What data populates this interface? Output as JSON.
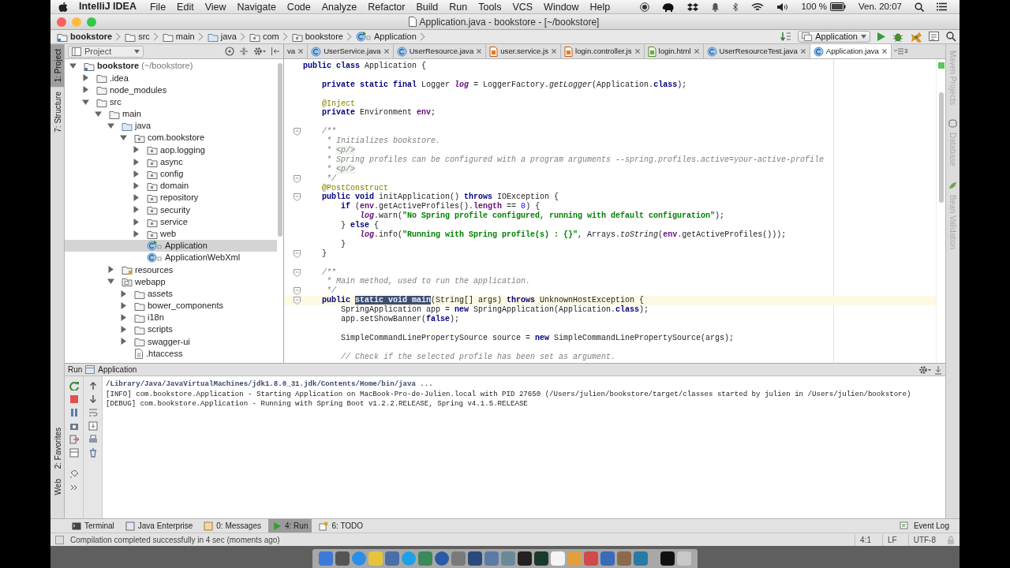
{
  "menubar": {
    "app": "IntelliJ IDEA",
    "menus": [
      "File",
      "Edit",
      "View",
      "Navigate",
      "Code",
      "Analyze",
      "Refactor",
      "Build",
      "Run",
      "Tools",
      "VCS",
      "Window",
      "Help"
    ],
    "battery": "100 %",
    "clock": "Ven. 20:07"
  },
  "window": {
    "title": "Application.java - bookstore - [~/bookstore]"
  },
  "breadcrumbs": [
    {
      "label": "bookstore",
      "kind": "project"
    },
    {
      "label": "src",
      "kind": "folder"
    },
    {
      "label": "main",
      "kind": "folder"
    },
    {
      "label": "java",
      "kind": "source"
    },
    {
      "label": "com",
      "kind": "package"
    },
    {
      "label": "bookstore",
      "kind": "package"
    },
    {
      "label": "Application",
      "kind": "class"
    }
  ],
  "run_config": "Application",
  "left_strip_top": [
    {
      "label": "1: Project",
      "selected": true
    },
    {
      "label": "7: Structure",
      "selected": false
    }
  ],
  "left_strip_bottom": [
    {
      "label": "2: Favorites",
      "selected": false
    },
    {
      "label": "Web",
      "selected": false
    }
  ],
  "project_panel": {
    "title": "Project",
    "tree": [
      {
        "label": "bookstore",
        "hint": "(~/bookstore)",
        "kind": "project",
        "expanded": true,
        "selected": false,
        "children": [
          {
            "label": ".idea",
            "kind": "folder",
            "expanded": false,
            "selected": false
          },
          {
            "label": "node_modules",
            "kind": "folder",
            "expanded": false,
            "selected": false
          },
          {
            "label": "src",
            "kind": "folder",
            "expanded": true,
            "selected": false,
            "children": [
              {
                "label": "main",
                "kind": "folder",
                "expanded": true,
                "selected": false,
                "children": [
                  {
                    "label": "java",
                    "kind": "source",
                    "expanded": true,
                    "selected": false,
                    "children": [
                      {
                        "label": "com.bookstore",
                        "kind": "package",
                        "expanded": true,
                        "selected": false,
                        "children": [
                          {
                            "label": "aop.logging",
                            "kind": "package",
                            "expanded": false,
                            "selected": false
                          },
                          {
                            "label": "async",
                            "kind": "package",
                            "expanded": false,
                            "selected": false
                          },
                          {
                            "label": "config",
                            "kind": "package",
                            "expanded": false,
                            "selected": false
                          },
                          {
                            "label": "domain",
                            "kind": "package",
                            "expanded": false,
                            "selected": false
                          },
                          {
                            "label": "repository",
                            "kind": "package",
                            "expanded": false,
                            "selected": false
                          },
                          {
                            "label": "security",
                            "kind": "package",
                            "expanded": false,
                            "selected": false
                          },
                          {
                            "label": "service",
                            "kind": "package",
                            "expanded": false,
                            "selected": false
                          },
                          {
                            "label": "web",
                            "kind": "package",
                            "expanded": false,
                            "selected": false
                          },
                          {
                            "label": "Application",
                            "kind": "runclass",
                            "selected": true
                          },
                          {
                            "label": "ApplicationWebXml",
                            "kind": "class",
                            "selected": false
                          }
                        ]
                      }
                    ]
                  },
                  {
                    "label": "resources",
                    "kind": "resources",
                    "expanded": false,
                    "selected": false
                  },
                  {
                    "label": "webapp",
                    "kind": "webapp",
                    "expanded": true,
                    "selected": false,
                    "children": [
                      {
                        "label": "assets",
                        "kind": "folder",
                        "expanded": false,
                        "selected": false
                      },
                      {
                        "label": "bower_components",
                        "kind": "folder",
                        "expanded": false,
                        "selected": false
                      },
                      {
                        "label": "i18n",
                        "kind": "folder",
                        "expanded": false,
                        "selected": false
                      },
                      {
                        "label": "scripts",
                        "kind": "folder",
                        "expanded": false,
                        "selected": false
                      },
                      {
                        "label": "swagger-ui",
                        "kind": "folder",
                        "expanded": false,
                        "selected": false
                      },
                      {
                        "label": ".htaccess",
                        "kind": "file",
                        "selected": false
                      }
                    ]
                  }
                ]
              }
            ]
          }
        ]
      }
    ]
  },
  "editor": {
    "tabs": [
      {
        "label": "va",
        "kind": "partial",
        "selected": false
      },
      {
        "label": "UserService.java",
        "kind": "java",
        "selected": false
      },
      {
        "label": "UserResource.java",
        "kind": "java",
        "selected": false
      },
      {
        "label": "user.service.js",
        "kind": "js",
        "selected": false
      },
      {
        "label": "login.controller.js",
        "kind": "js",
        "selected": false
      },
      {
        "label": "login.html",
        "kind": "html",
        "selected": false
      },
      {
        "label": "UserResourceTest.java",
        "kind": "java",
        "selected": false
      },
      {
        "label": "Application.java",
        "kind": "java",
        "selected": true
      }
    ],
    "overflow": "3",
    "lines": [
      {
        "kind": "code",
        "fold": false,
        "current": false,
        "tokens": [
          {
            "kind": "keyword",
            "text": "public class "
          },
          {
            "kind": "plain",
            "text": "Application {"
          }
        ]
      },
      {
        "kind": "blank"
      },
      {
        "kind": "code",
        "fold": false,
        "current": false,
        "tokens": [
          {
            "kind": "keyword",
            "text": "    private static final "
          },
          {
            "kind": "plain",
            "text": "Logger "
          },
          {
            "kind": "static_field",
            "text": "log"
          },
          {
            "kind": "plain",
            "text": " = LoggerFactory."
          },
          {
            "kind": "italic",
            "text": "getLogger"
          },
          {
            "kind": "plain",
            "text": "(Application."
          },
          {
            "kind": "keyword",
            "text": "class"
          },
          {
            "kind": "plain",
            "text": ");"
          }
        ]
      },
      {
        "kind": "blank"
      },
      {
        "kind": "code",
        "fold": false,
        "current": false,
        "tokens": [
          {
            "kind": "annotation",
            "text": "    @Inject"
          }
        ]
      },
      {
        "kind": "code",
        "fold": false,
        "current": false,
        "tokens": [
          {
            "kind": "keyword",
            "text": "    private "
          },
          {
            "kind": "plain",
            "text": "Environment "
          },
          {
            "kind": "field",
            "text": "env"
          },
          {
            "kind": "plain",
            "text": ";"
          }
        ]
      },
      {
        "kind": "blank"
      },
      {
        "kind": "code",
        "fold": true,
        "current": false,
        "tokens": [
          {
            "kind": "comment",
            "text": "    /**"
          }
        ]
      },
      {
        "kind": "code",
        "fold": false,
        "current": false,
        "tokens": [
          {
            "kind": "comment",
            "text": "     * Initializes bookstore."
          }
        ]
      },
      {
        "kind": "code",
        "fold": false,
        "current": false,
        "tokens": [
          {
            "kind": "comment",
            "text": "     * "
          },
          {
            "kind": "doc_tag",
            "text": "<p/>"
          }
        ]
      },
      {
        "kind": "code",
        "fold": false,
        "current": false,
        "tokens": [
          {
            "kind": "comment",
            "text": "     * Spring profiles can be configured with a program arguments --spring.profiles.active=your-active-profile"
          }
        ]
      },
      {
        "kind": "code",
        "fold": false,
        "current": false,
        "tokens": [
          {
            "kind": "comment",
            "text": "     * "
          },
          {
            "kind": "doc_tag",
            "text": "<p/>"
          }
        ]
      },
      {
        "kind": "code",
        "fold": true,
        "current": false,
        "tokens": [
          {
            "kind": "comment",
            "text": "     */"
          }
        ]
      },
      {
        "kind": "code",
        "fold": false,
        "current": false,
        "tokens": [
          {
            "kind": "annotation",
            "text": "    @PostConstruct"
          }
        ]
      },
      {
        "kind": "code",
        "fold": true,
        "current": false,
        "tokens": [
          {
            "kind": "keyword",
            "text": "    public void "
          },
          {
            "kind": "plain",
            "text": "initApplication() "
          },
          {
            "kind": "keyword",
            "text": "throws "
          },
          {
            "kind": "plain",
            "text": "IOException {"
          }
        ]
      },
      {
        "kind": "code",
        "fold": false,
        "current": false,
        "tokens": [
          {
            "kind": "keyword",
            "text": "        if "
          },
          {
            "kind": "plain",
            "text": "("
          },
          {
            "kind": "field",
            "text": "env"
          },
          {
            "kind": "plain",
            "text": ".getActiveProfiles()."
          },
          {
            "kind": "field",
            "text": "length"
          },
          {
            "kind": "plain",
            "text": " == "
          },
          {
            "kind": "number",
            "text": "0"
          },
          {
            "kind": "plain",
            "text": ") {"
          }
        ]
      },
      {
        "kind": "code",
        "fold": false,
        "current": false,
        "tokens": [
          {
            "kind": "static_field",
            "text": "            log"
          },
          {
            "kind": "plain",
            "text": ".warn("
          },
          {
            "kind": "string",
            "text": "\"No Spring profile configured, running with default configuration\""
          },
          {
            "kind": "plain",
            "text": ");"
          }
        ]
      },
      {
        "kind": "code",
        "fold": false,
        "current": false,
        "tokens": [
          {
            "kind": "plain",
            "text": "        } "
          },
          {
            "kind": "keyword",
            "text": "else "
          },
          {
            "kind": "plain",
            "text": "{"
          }
        ]
      },
      {
        "kind": "code",
        "fold": false,
        "current": false,
        "tokens": [
          {
            "kind": "static_field",
            "text": "            log"
          },
          {
            "kind": "plain",
            "text": ".info("
          },
          {
            "kind": "string",
            "text": "\"Running with Spring profile(s) : {}\""
          },
          {
            "kind": "plain",
            "text": ", Arrays."
          },
          {
            "kind": "italic",
            "text": "toString"
          },
          {
            "kind": "plain",
            "text": "("
          },
          {
            "kind": "field",
            "text": "env"
          },
          {
            "kind": "plain",
            "text": ".getActiveProfiles()));"
          }
        ]
      },
      {
        "kind": "code",
        "fold": false,
        "current": false,
        "tokens": [
          {
            "kind": "plain",
            "text": "        }"
          }
        ]
      },
      {
        "kind": "code",
        "fold": true,
        "current": false,
        "tokens": [
          {
            "kind": "plain",
            "text": "    }"
          }
        ]
      },
      {
        "kind": "blank"
      },
      {
        "kind": "code",
        "fold": true,
        "current": false,
        "tokens": [
          {
            "kind": "comment",
            "text": "    /**"
          }
        ]
      },
      {
        "kind": "code",
        "fold": false,
        "current": false,
        "tokens": [
          {
            "kind": "comment",
            "text": "     * Main method, used to run the application."
          }
        ]
      },
      {
        "kind": "code",
        "fold": true,
        "current": false,
        "tokens": [
          {
            "kind": "comment",
            "text": "     */"
          }
        ]
      },
      {
        "kind": "code",
        "fold": true,
        "current": true,
        "tokens": [
          {
            "kind": "keyword",
            "text": "    public "
          },
          {
            "kind": "selection",
            "text": "static void main"
          },
          {
            "kind": "plain",
            "text": "(String[] args) "
          },
          {
            "kind": "keyword",
            "text": "throws "
          },
          {
            "kind": "plain",
            "text": "UnknownHostException {"
          }
        ]
      },
      {
        "kind": "code",
        "fold": false,
        "current": false,
        "tokens": [
          {
            "kind": "plain",
            "text": "        SpringApplication app = "
          },
          {
            "kind": "keyword",
            "text": "new "
          },
          {
            "kind": "plain",
            "text": "SpringApplication(Application."
          },
          {
            "kind": "keyword",
            "text": "class"
          },
          {
            "kind": "plain",
            "text": ");"
          }
        ]
      },
      {
        "kind": "code",
        "fold": false,
        "current": false,
        "tokens": [
          {
            "kind": "plain",
            "text": "        app.setShowBanner("
          },
          {
            "kind": "keyword",
            "text": "false"
          },
          {
            "kind": "plain",
            "text": ");"
          }
        ]
      },
      {
        "kind": "blank"
      },
      {
        "kind": "code",
        "fold": false,
        "current": false,
        "tokens": [
          {
            "kind": "plain",
            "text": "        SimpleCommandLinePropertySource source = "
          },
          {
            "kind": "keyword",
            "text": "new "
          },
          {
            "kind": "plain",
            "text": "SimpleCommandLinePropertySource(args);"
          }
        ]
      },
      {
        "kind": "blank"
      },
      {
        "kind": "code",
        "fold": false,
        "current": false,
        "tokens": [
          {
            "kind": "comment",
            "text": "        // Check if the selected profile has been set as argument."
          }
        ]
      }
    ]
  },
  "right_strip": [
    "Maven Projects",
    "Database",
    "Bean Validation"
  ],
  "run_panel": {
    "title": "Run",
    "config": "Application",
    "console": [
      {
        "kind": "command",
        "text": "/Library/Java/JavaVirtualMachines/jdk1.8.0_31.jdk/Contents/Home/bin/java ..."
      },
      {
        "kind": "output",
        "text": "[INFO] com.bookstore.Application - Starting Application on MacBook-Pro-de-Julien.local with PID 27650 (/Users/julien/bookstore/target/classes started by julien in /Users/julien/bookstore)"
      },
      {
        "kind": "output",
        "text": "[DEBUG] com.bookstore.Application - Running with Spring Boot v1.2.2.RELEASE, Spring v4.1.5.RELEASE"
      }
    ]
  },
  "tool_tabs": [
    {
      "label": "Terminal",
      "selected": false
    },
    {
      "label": "Java Enterprise",
      "selected": false
    },
    {
      "label": "0: Messages",
      "selected": false
    },
    {
      "label": "4: Run",
      "selected": true
    },
    {
      "label": "6: TODO",
      "selected": false
    }
  ],
  "event_log": "Event Log",
  "status_bar": {
    "message": "Compilation completed successfully in 4 sec (moments ago)",
    "position": "4:1",
    "line_separator": "LF",
    "encoding": "UTF-8"
  }
}
